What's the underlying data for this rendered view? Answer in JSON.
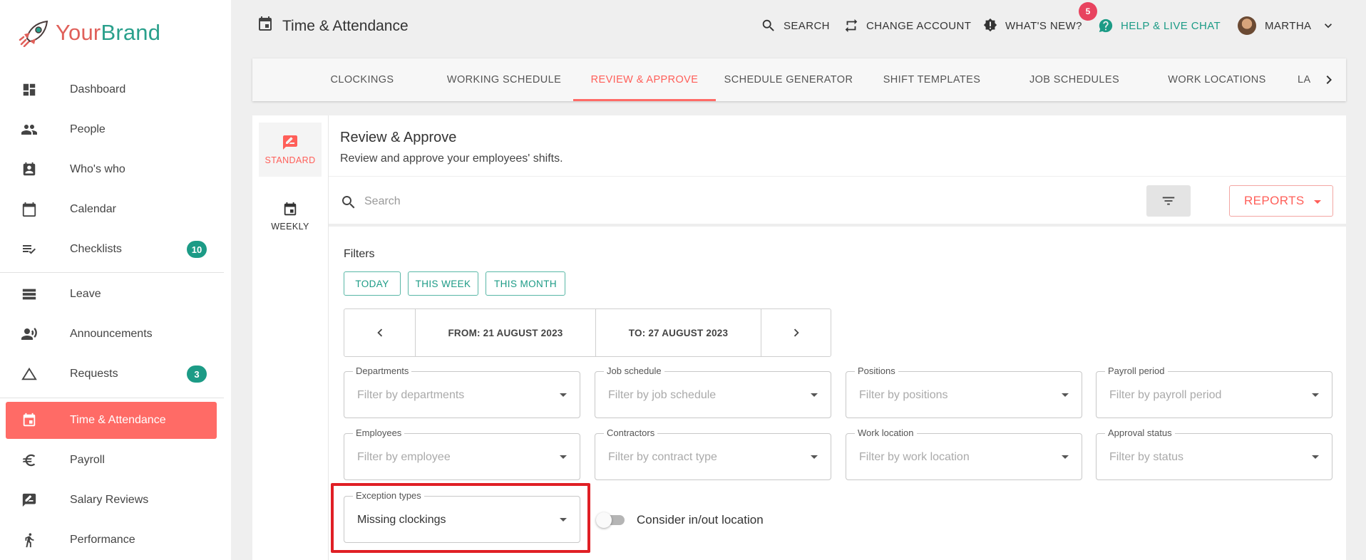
{
  "brand": {
    "part1": "Your",
    "part2": "Brand"
  },
  "sidebar": {
    "items": [
      {
        "label": "Dashboard",
        "icon": "dashboard-icon"
      },
      {
        "label": "People",
        "icon": "people-icon"
      },
      {
        "label": "Who's who",
        "icon": "contact-card-icon"
      },
      {
        "label": "Calendar",
        "icon": "calendar-icon"
      },
      {
        "label": "Checklists",
        "icon": "checklist-icon",
        "badge": "10"
      },
      {
        "label": "Leave",
        "icon": "leave-icon"
      },
      {
        "label": "Announcements",
        "icon": "announcement-icon"
      },
      {
        "label": "Requests",
        "icon": "triangle-icon",
        "badge": "3"
      },
      {
        "label": "Time & Attendance",
        "icon": "event-icon",
        "active": true
      },
      {
        "label": "Payroll",
        "icon": "euro-icon"
      },
      {
        "label": "Salary Reviews",
        "icon": "salary-review-icon"
      },
      {
        "label": "Performance",
        "icon": "running-person-icon"
      }
    ]
  },
  "header": {
    "title": "Time & Attendance",
    "search": "SEARCH",
    "change_account": "CHANGE ACCOUNT",
    "whats_new": "WHAT'S NEW?",
    "whats_new_badge": "5",
    "help": "HELP & LIVE CHAT",
    "user": "MARTHA"
  },
  "tabs": [
    {
      "label": "CLOCKINGS"
    },
    {
      "label": "WORKING SCHEDULE"
    },
    {
      "label": "REVIEW & APPROVE",
      "active": true
    },
    {
      "label": "SCHEDULE GENERATOR"
    },
    {
      "label": "SHIFT TEMPLATES"
    },
    {
      "label": "JOB SCHEDULES"
    },
    {
      "label": "WORK LOCATIONS"
    },
    {
      "label": "LA"
    }
  ],
  "modes": {
    "standard": "STANDARD",
    "weekly": "WEEKLY"
  },
  "page": {
    "title": "Review & Approve",
    "subtitle": "Review and approve your employees' shifts.",
    "search_placeholder": "Search",
    "reports": "REPORTS"
  },
  "filters": {
    "label": "Filters",
    "chips": {
      "today": "TODAY",
      "this_week": "THIS WEEK",
      "this_month": "THIS MONTH"
    },
    "from": "FROM: 21 AUGUST 2023",
    "to": "TO: 27 AUGUST 2023",
    "fields": {
      "departments": {
        "label": "Departments",
        "placeholder": "Filter by departments"
      },
      "job_schedule": {
        "label": "Job schedule",
        "placeholder": "Filter by job schedule"
      },
      "positions": {
        "label": "Positions",
        "placeholder": "Filter by positions"
      },
      "payroll_period": {
        "label": "Payroll period",
        "placeholder": "Filter by payroll period"
      },
      "employees": {
        "label": "Employees",
        "placeholder": "Filter by employee"
      },
      "contractors": {
        "label": "Contractors",
        "placeholder": "Filter by contract type"
      },
      "work_location": {
        "label": "Work location",
        "placeholder": "Filter by work location"
      },
      "approval_status": {
        "label": "Approval status",
        "placeholder": "Filter by status"
      },
      "exception_types": {
        "label": "Exception types",
        "value": "Missing clockings"
      }
    },
    "toggle_label": "Consider in/out location",
    "toggle_on": false
  },
  "colors": {
    "accent": "#ff6b66",
    "teal": "#1c9b86",
    "highlight": "#e01f25"
  }
}
